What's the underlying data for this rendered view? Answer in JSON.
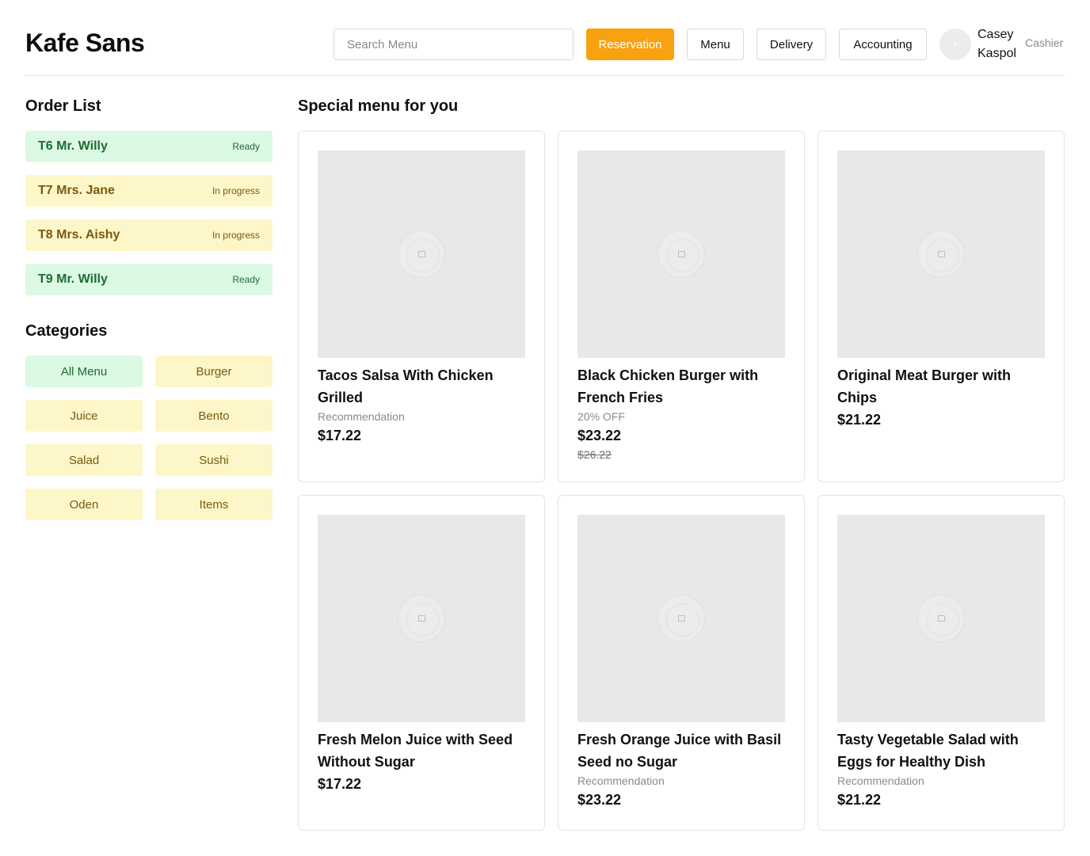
{
  "header": {
    "brand": "Kafe Sans",
    "search_placeholder": "Search Menu",
    "nav": [
      "Reservation",
      "Menu",
      "Delivery",
      "Accounting"
    ],
    "active_nav": "Reservation",
    "user_name": "Casey Kaspol",
    "user_role": "Cashier"
  },
  "sidebar": {
    "order_title": "Order List",
    "orders": [
      {
        "name": "T6 Mr. Willy",
        "status": "Ready"
      },
      {
        "name": "T7 Mrs. Jane",
        "status": "In progress"
      },
      {
        "name": "T8 Mrs. Aishy",
        "status": "In progress"
      },
      {
        "name": "T9 Mr. Willy",
        "status": "Ready"
      }
    ],
    "categories_title": "Categories",
    "categories": [
      "All Menu",
      "Burger",
      "Juice",
      "Bento",
      "Salad",
      "Sushi",
      "Oden",
      "Items"
    ],
    "active_category": "All Menu"
  },
  "main": {
    "title": "Special menu for you",
    "items": [
      {
        "name": "Tacos Salsa With Chicken Grilled",
        "tag": "Recommendation",
        "price": "$17.22",
        "old_price": ""
      },
      {
        "name": "Black Chicken Burger with French Fries",
        "tag": "20% OFF",
        "price": "$23.22",
        "old_price": "$26.22"
      },
      {
        "name": "Original Meat Burger with Chips",
        "tag": "",
        "price": "$21.22",
        "old_price": ""
      },
      {
        "name": "Fresh Melon Juice with Seed Without Sugar",
        "tag": "",
        "price": "$17.22",
        "old_price": ""
      },
      {
        "name": "Fresh Orange Juice with Basil Seed no Sugar",
        "tag": "Recommendation",
        "price": "$23.22",
        "old_price": ""
      },
      {
        "name": "Tasty Vegetable Salad with Eggs for Healthy Dish",
        "tag": "Recommendation",
        "price": "$21.22",
        "old_price": ""
      }
    ]
  },
  "colors": {
    "accent": "#f8a20f",
    "ready_bg": "#dcf9e4",
    "ready_text": "#1d6b33",
    "progress_bg": "#fdf6c8",
    "progress_text": "#7a5a10"
  }
}
